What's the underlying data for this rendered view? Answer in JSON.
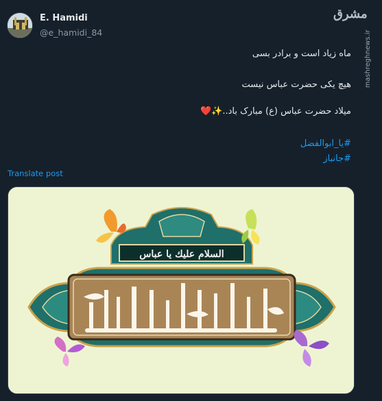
{
  "author": {
    "name": "E. Hamidi",
    "handle": "@e_hamidi_84"
  },
  "post": {
    "line1": "ماه زیاد است و برادر بسی",
    "line2": "هیچ یکی حضرت عباس نیست",
    "line3": "میلاد حضرت عباس (ع) مبارک باد..✨❤️",
    "hashtag1": "#یا_ابوالفضل",
    "hashtag2": "#جانباز"
  },
  "translate_label": "Translate post",
  "watermark": {
    "logo": "مشرق",
    "url": "mashreghnews.ir"
  },
  "media": {
    "icons": [
      "butterfly-icon",
      "butterfly-icon",
      "butterfly-icon",
      "butterfly-icon"
    ],
    "colors": {
      "background": "#eef4d2",
      "frame": "#1f6f6a",
      "panel": "#a98556",
      "accent_orange": "#f29a2e",
      "accent_purple": "#a86ad0"
    }
  }
}
